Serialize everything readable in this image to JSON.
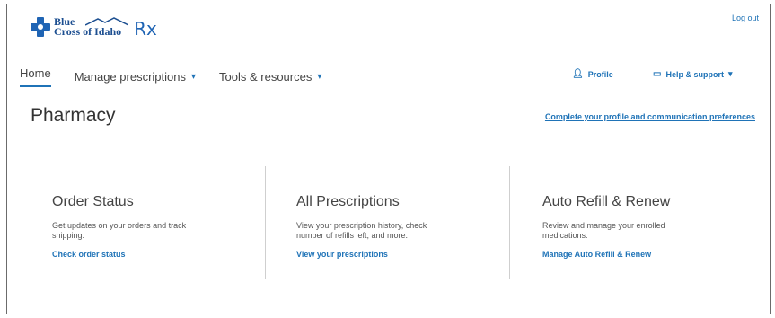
{
  "header": {
    "logo_line1": "Blue",
    "logo_line2": "Cross of Idaho",
    "logo_rx": "Rx",
    "logout": "Log out"
  },
  "nav": {
    "home": "Home",
    "manage": "Manage prescriptions",
    "tools": "Tools & resources",
    "profile": "Profile",
    "help": "Help & support"
  },
  "page": {
    "title": "Pharmacy",
    "prefs_link": "Complete your profile and communication preferences"
  },
  "cards": [
    {
      "title": "Order Status",
      "desc": "Get updates on your orders and track shipping.",
      "link": "Check order status"
    },
    {
      "title": "All Prescriptions",
      "desc": "View your prescription history, check number of refills left, and more.",
      "link": "View your prescriptions"
    },
    {
      "title": "Auto Refill & Renew",
      "desc": "Review and manage your enrolled medications.",
      "link": "Manage Auto Refill & Renew"
    }
  ],
  "colors": {
    "accent": "#1f73b7",
    "brand": "#1d4f91"
  }
}
